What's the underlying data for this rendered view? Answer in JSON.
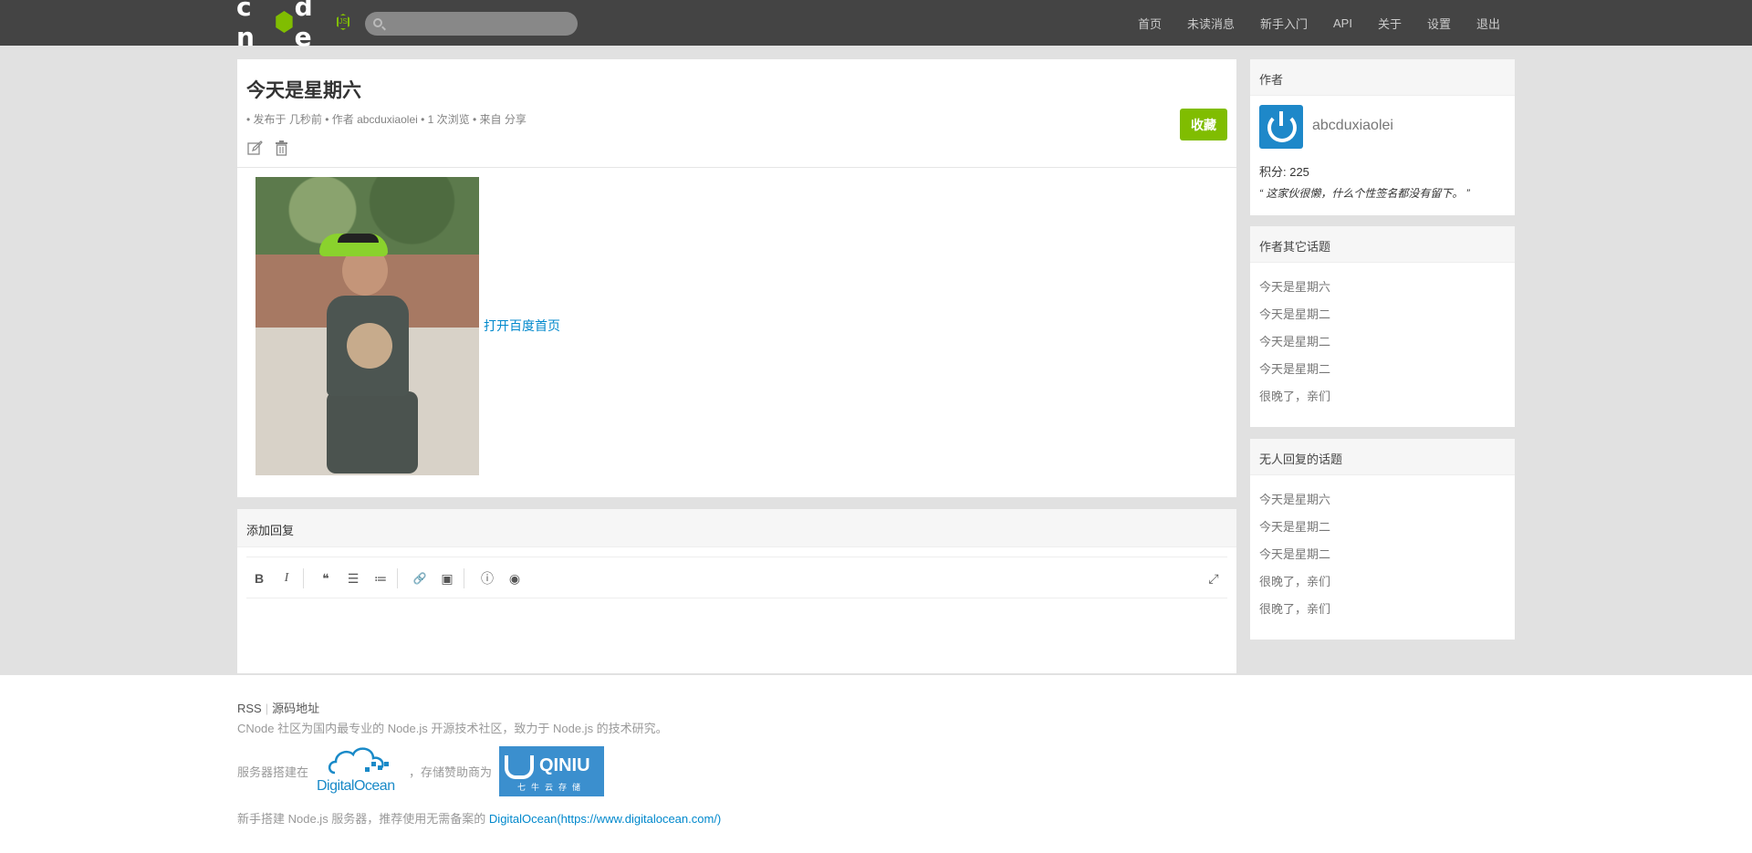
{
  "navbar": {
    "logo_text": "cnode",
    "logo_js": "JS",
    "search_placeholder": "",
    "links": [
      "首页",
      "未读消息",
      "新手入门",
      "API",
      "关于",
      "设置",
      "退出"
    ]
  },
  "topic": {
    "title": "今天是星期六",
    "meta": "• 发布于 几秒前 • 作者 abcduxiaolei • 1 次浏览 • 来自 分享",
    "favorite_label": "收藏",
    "link_text": "打开百度首页"
  },
  "reply": {
    "title": "添加回复",
    "toolbar": {
      "bold": "B",
      "italic": "I",
      "quote": "❝",
      "ul": "☰",
      "ol": "≔",
      "link": "🔗",
      "image": "▣",
      "info": "ⓘ",
      "preview": "◉",
      "fullscreen": "⤢"
    }
  },
  "sidebar": {
    "author_header": "作者",
    "author_name": "abcduxiaolei",
    "author_score": "积分: 225",
    "author_signature": "“ 这家伙很懒，什么个性签名都没有留下。 ”",
    "other_topics_header": "作者其它话题",
    "other_topics": [
      "今天是星期六",
      "今天是星期二",
      "今天是星期二",
      "今天是星期二",
      "很晚了，亲们"
    ],
    "no_reply_header": "无人回复的话题",
    "no_reply_topics": [
      "今天是星期六",
      "今天是星期二",
      "今天是星期二",
      "很晚了，亲们",
      "很晚了，亲们"
    ]
  },
  "footer": {
    "rss": "RSS",
    "source": "源码地址",
    "description": "CNode 社区为国内最专业的 Node.js 开源技术社区，致力于 Node.js 的技术研究。",
    "host_prefix": "服务器搭建在",
    "digitalocean": "DigitalOcean",
    "host_middle": "，存储赞助商为",
    "qiniu": "QINIU",
    "qiniu_sub": "七牛云存储",
    "tip_prefix": "新手搭建 Node.js 服务器，推荐使用无需备案的 ",
    "tip_link": "DigitalOcean(https://www.digitalocean.com/)"
  },
  "colors": {
    "navbar_bg": "#444444",
    "accent_green": "#80bd01",
    "link_blue": "#0088cc",
    "page_bg": "#e1e1e1"
  }
}
